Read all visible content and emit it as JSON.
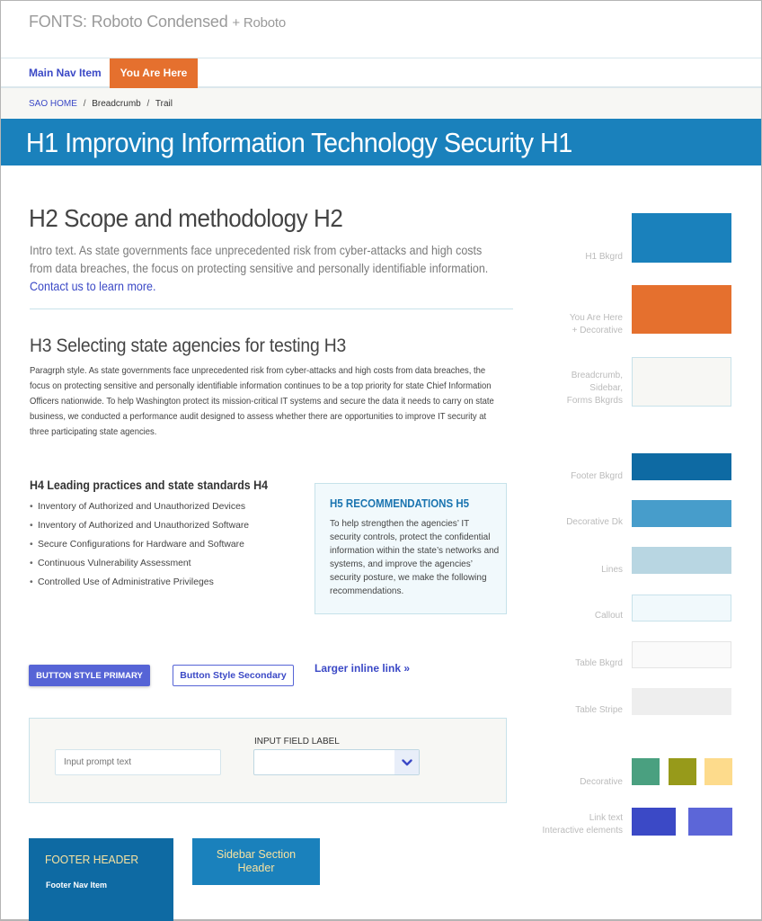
{
  "header": {
    "fonts_label": "FONTS: Roboto Condensed",
    "fonts_plus": "+ Roboto"
  },
  "nav": {
    "main_item": "Main Nav Item",
    "current_item": "You Are Here"
  },
  "breadcrumb": {
    "home": "SAO HOME",
    "separator": "/",
    "items": [
      "Breadcrumb",
      "Trail"
    ]
  },
  "h1": "H1 Improving Information Technology Security H1",
  "h2": "H2 Scope and methodology H2",
  "intro": {
    "text": "Intro text. As state governments face unprecedented risk from cyber-attacks and high costs from data breaches, the focus on protecting sensitive and personally identifiable information.",
    "link": "Contact us to learn more."
  },
  "h3": "H3 Selecting state agencies for testing H3",
  "paragraph": "Paragrph style. As state governments face unprecedented risk from cyber-attacks and high costs from data breaches, the focus on protecting sensitive and personally identifiable information continues to be a top priority for state Chief Information Officers nationwide. To help Washington protect its mission-critical IT systems and secure the data it needs to carry on state business, we conducted a performance audit designed to assess whether there are opportunities to improve IT security at three participating state agencies.",
  "h4": "H4 Leading practices and state standards H4",
  "bullets": [
    "Inventory of Authorized and Unauthorized Devices",
    "Inventory of Authorized and Unauthorized Software",
    "Secure Configurations for Hardware and Software",
    "Continuous Vulnerability Assessment",
    "Controlled Use of Administrative Privileges"
  ],
  "bullet_glyph": "•",
  "callout": {
    "title": "H5 RECOMMENDATIONS H5",
    "body": "To help strengthen the agencies’ IT security controls, protect the confidential information within the state’s networks and systems, and improve the agencies’ security posture, we make the following recommendations."
  },
  "buttons": {
    "primary": "BUTTON STYLE PRIMARY",
    "secondary": "Button Style Secondary",
    "inline_link": "Larger inline link »"
  },
  "form": {
    "input_placeholder": "Input prompt text",
    "select_label": "INPUT FIELD LABEL",
    "select_value": "",
    "select_icon": "chevron-down-icon"
  },
  "footer": {
    "header": "FOOTER HEADER",
    "nav_item": "Footer Nav Item"
  },
  "sidebar": {
    "section_header_line1": "Sidebar Section",
    "section_header_line2": "Header"
  },
  "palette": [
    {
      "label": "H1 Bkgrd",
      "colors": [
        "#1a81bc"
      ]
    },
    {
      "label": "You Are Here\n+ Decorative",
      "colors": [
        "#e5702e"
      ]
    },
    {
      "label": "Breadcrumb,\nSidebar,\nForms Bkgrds",
      "colors": [
        "#f7f7f4"
      ]
    },
    {
      "label": "Footer Bkgrd",
      "colors": [
        "#0e6aa3"
      ]
    },
    {
      "label": "Decorative Dk",
      "colors": [
        "#479dcb"
      ]
    },
    {
      "label": "Lines",
      "colors": [
        "#b8d6e2"
      ]
    },
    {
      "label": "Callout",
      "colors": [
        "#f1f9fc"
      ]
    },
    {
      "label": "Table Bkgrd",
      "colors": [
        "#fafafa"
      ]
    },
    {
      "label": "Table Stripe",
      "colors": [
        "#eeeeee"
      ]
    },
    {
      "label": "Decorative",
      "colors": [
        "#4aa080",
        "#979a1a",
        "#fddb8c"
      ]
    },
    {
      "label": "Link text\nInteractive elements",
      "colors": [
        "#3b49c6",
        "#5c66d8"
      ]
    }
  ]
}
